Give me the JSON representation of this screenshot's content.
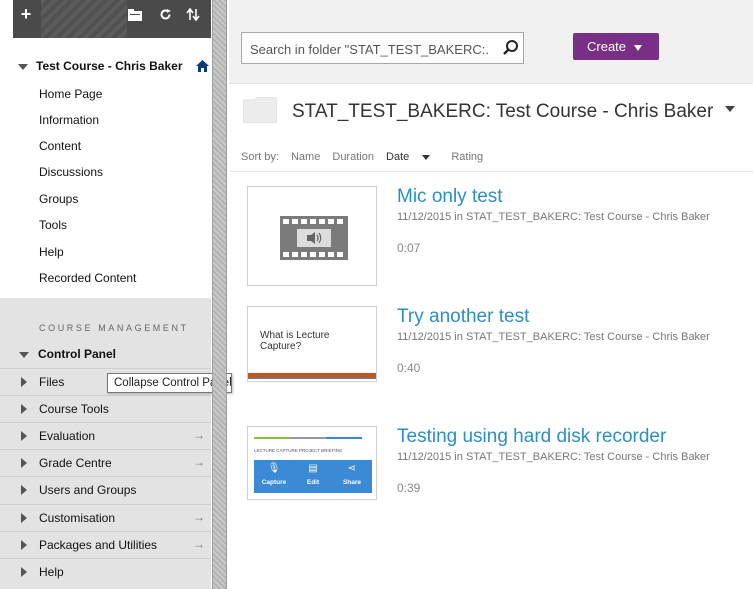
{
  "sidebar": {
    "course_title": "Test Course - Chris Baker",
    "menu_items": [
      {
        "label": "Home Page"
      },
      {
        "label": "Information"
      },
      {
        "label": "Content"
      },
      {
        "label": "Discussions"
      },
      {
        "label": "Groups"
      },
      {
        "label": "Tools"
      },
      {
        "label": "Help"
      },
      {
        "label": "Recorded Content"
      }
    ],
    "management_heading": "COURSE MANAGEMENT",
    "control_panel_title": "Control Panel",
    "control_panel_items": [
      {
        "label": "Files",
        "has_arrow": false
      },
      {
        "label": "Course Tools",
        "has_arrow": false
      },
      {
        "label": "Evaluation",
        "has_arrow": true
      },
      {
        "label": "Grade Centre",
        "has_arrow": true
      },
      {
        "label": "Users and Groups",
        "has_arrow": false
      },
      {
        "label": "Customisation",
        "has_arrow": true
      },
      {
        "label": "Packages and Utilities",
        "has_arrow": true
      },
      {
        "label": "Help",
        "has_arrow": false
      }
    ],
    "tooltip": "Collapse Control Panel",
    "arrow_glyph": "→"
  },
  "toolbar": {
    "search_placeholder": "Search in folder \"STAT_TEST_BAKERC:...",
    "create_label": "Create"
  },
  "folder": {
    "title": "STAT_TEST_BAKERC: Test Course - Chris Baker"
  },
  "sort": {
    "label": "Sort by:",
    "options": [
      "Name",
      "Duration",
      "Date",
      "Rating"
    ],
    "active": "Date"
  },
  "sessions": [
    {
      "title": "Mic only test",
      "date": "11/12/2015",
      "location": "STAT_TEST_BAKERC: Test Course - Chris Baker",
      "duration": "0:07",
      "thumb": "audio-film-icon"
    },
    {
      "title": "Try another test",
      "date": "11/12/2015",
      "location": "STAT_TEST_BAKERC: Test Course - Chris Baker",
      "duration": "0:40",
      "thumb": "slide-what-is-lecture-capture"
    },
    {
      "title": "Testing using hard disk recorder",
      "date": "11/12/2015",
      "location": "STAT_TEST_BAKERC: Test Course - Chris Baker",
      "duration": "0:39",
      "thumb": "slide-lecture-capture-briefing"
    }
  ],
  "thumb_text": {
    "t2_line": "What is Lecture Capture?",
    "t3_head": "LECTURE CAPTURE PROJECT BRIEFING",
    "t3_buttons": [
      "Capture",
      "Edit",
      "Share"
    ]
  },
  "colors": {
    "accent_purple": "#7a2f86",
    "link_blue": "#2a8fc9",
    "sidebar_dark": "#4a4a4a",
    "panel_gray": "#e3e3e3"
  }
}
